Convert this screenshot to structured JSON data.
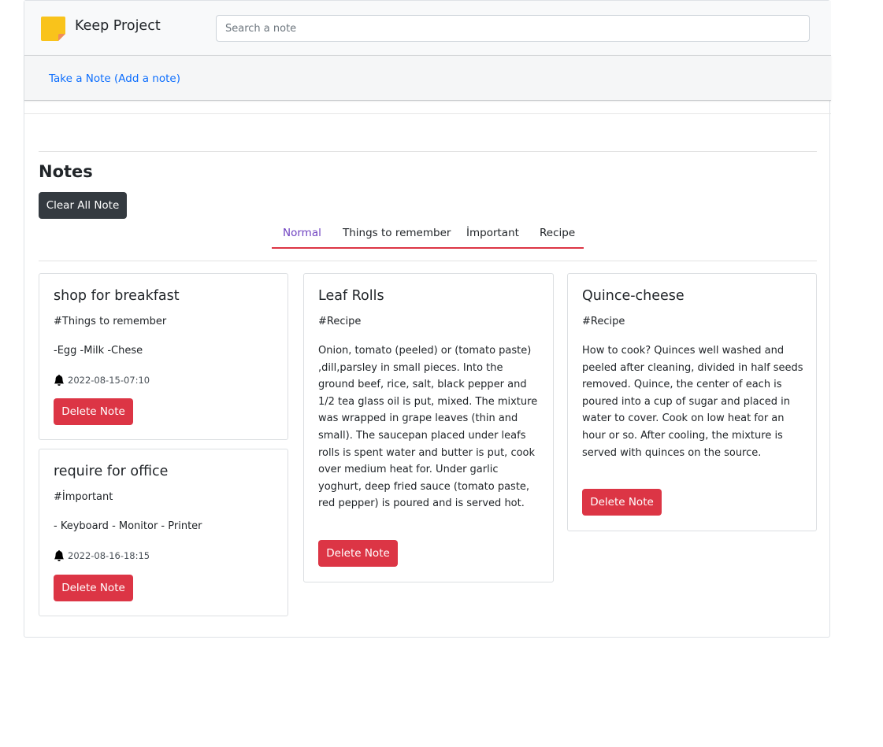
{
  "app": {
    "title": "Keep Project",
    "logo_icon": "sticky-note-icon",
    "logo_colors": {
      "note": "#f9c31b",
      "fold": "#f08c5a"
    }
  },
  "search": {
    "placeholder": "Search a note",
    "value": ""
  },
  "take_note": {
    "link_text": "Take a Note (Add a note)"
  },
  "notes_section": {
    "heading": "Notes",
    "clear_all_label": "Clear All Note"
  },
  "tabs": [
    {
      "label": "Normal",
      "active": true
    },
    {
      "label": "Things to remember",
      "active": false
    },
    {
      "label": "İmportant",
      "active": false
    },
    {
      "label": "Recipe",
      "active": false
    }
  ],
  "notes": [
    {
      "title": "shop for breakfast",
      "tag": "#Things to remember",
      "body": "-Egg -Milk -Chese",
      "reminder": "2022-08-15-07:10",
      "delete_label": "Delete Note"
    },
    {
      "title": "require for office",
      "tag": "#İmportant",
      "body": "- Keyboard - Monitor - Printer",
      "reminder": "2022-08-16-18:15",
      "delete_label": "Delete Note"
    },
    {
      "title": "Leaf Rolls",
      "tag": "#Recipe",
      "body": "Onion, tomato (peeled) or (tomato paste) ,dill,parsley in small pieces. Into the ground beef, rice, salt, black pepper and 1/2 tea glass oil is put, mixed. The mixture was wrapped in grape leaves (thin and small). The saucepan placed under leafs rolls is spent water and butter is put, cook over medium heat for. Under garlic yoghurt, deep fried sauce (tomato paste, red pepper) is poured and is served hot.",
      "reminder": "",
      "delete_label": "Delete Note"
    },
    {
      "title": "Quince-cheese",
      "tag": "#Recipe",
      "body": "How to cook? Quinces well washed and peeled after cleaning, divided in half seeds removed. Quince, the center of each is poured into a cup of sugar and placed in water to cover. Cook on low heat for an hour or so. After cooling, the mixture is served with quinces on the source.",
      "reminder": "",
      "delete_label": "Delete Note"
    }
  ],
  "colors": {
    "accent_link": "#0d6efd",
    "danger": "#dc3545",
    "dark_button": "#343a40",
    "active_tab": "#6f42c1",
    "reminder_icon": "bell-icon"
  }
}
